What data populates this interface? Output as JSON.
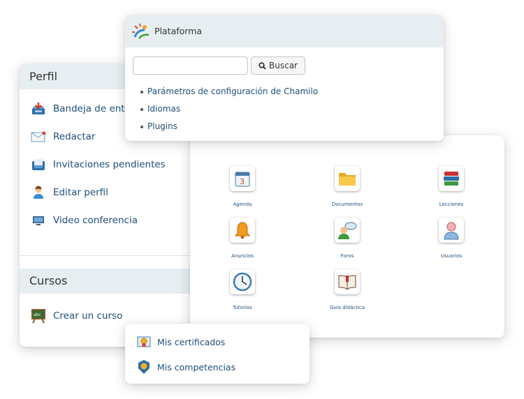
{
  "plataforma": {
    "title": "Plataforma",
    "search_button": "Buscar",
    "search_placeholder": "",
    "search_value": "",
    "links": [
      "Parámetros de configuración de Chamilo",
      "Idiomas",
      "Plugins"
    ]
  },
  "perfil": {
    "title": "Perfil",
    "items": [
      {
        "label": "Bandeja de entrada",
        "icon": "inbox-icon"
      },
      {
        "label": "Redactar",
        "icon": "envelope-icon"
      },
      {
        "label": "Invitaciones pendientes",
        "icon": "invitations-icon"
      },
      {
        "label": "Editar perfil",
        "icon": "user-icon"
      },
      {
        "label": "Video conferencia",
        "icon": "monitor-icon"
      }
    ]
  },
  "cursos": {
    "title": "Cursos",
    "items": [
      {
        "label": "Crear un curso",
        "icon": "chalkboard-icon"
      }
    ]
  },
  "tools": [
    {
      "label": "Agenda",
      "icon": "calendar-icon"
    },
    {
      "label": "Documentos",
      "icon": "folder-icon"
    },
    {
      "label": "Lecciones",
      "icon": "books-icon"
    },
    {
      "label": "Anuncios",
      "icon": "bell-icon"
    },
    {
      "label": "Foros",
      "icon": "forum-icon"
    },
    {
      "label": "Usuarios",
      "icon": "users-icon"
    },
    {
      "label": "Tutorías",
      "icon": "clock-icon"
    },
    {
      "label": "Guía didáctica",
      "icon": "book-icon"
    }
  ],
  "certificados": {
    "items": [
      {
        "label": "Mis certificados",
        "icon": "certificate-icon"
      },
      {
        "label": "Mis competencias",
        "icon": "badge-icon"
      }
    ]
  }
}
